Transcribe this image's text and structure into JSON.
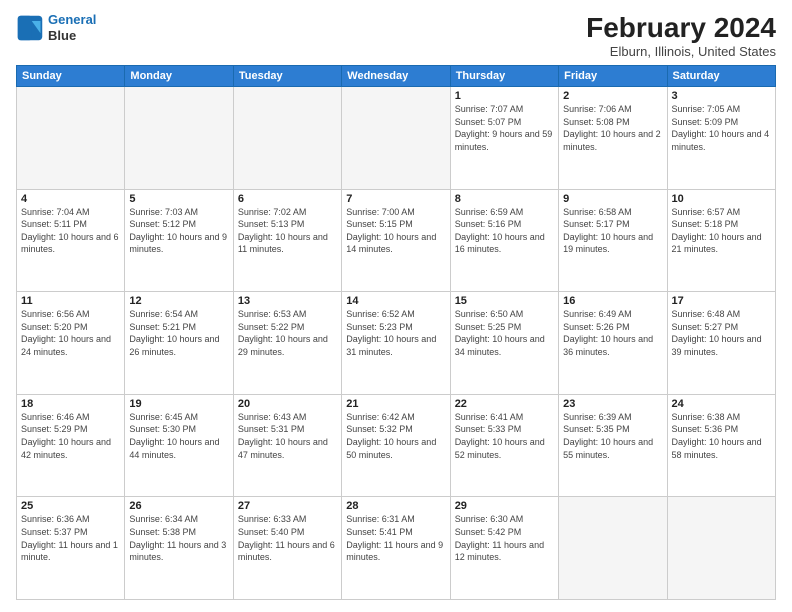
{
  "header": {
    "logo_line1": "General",
    "logo_line2": "Blue",
    "main_title": "February 2024",
    "sub_title": "Elburn, Illinois, United States"
  },
  "weekdays": [
    "Sunday",
    "Monday",
    "Tuesday",
    "Wednesday",
    "Thursday",
    "Friday",
    "Saturday"
  ],
  "weeks": [
    [
      {
        "day": "",
        "info": ""
      },
      {
        "day": "",
        "info": ""
      },
      {
        "day": "",
        "info": ""
      },
      {
        "day": "",
        "info": ""
      },
      {
        "day": "1",
        "info": "Sunrise: 7:07 AM\nSunset: 5:07 PM\nDaylight: 9 hours and 59 minutes."
      },
      {
        "day": "2",
        "info": "Sunrise: 7:06 AM\nSunset: 5:08 PM\nDaylight: 10 hours and 2 minutes."
      },
      {
        "day": "3",
        "info": "Sunrise: 7:05 AM\nSunset: 5:09 PM\nDaylight: 10 hours and 4 minutes."
      }
    ],
    [
      {
        "day": "4",
        "info": "Sunrise: 7:04 AM\nSunset: 5:11 PM\nDaylight: 10 hours and 6 minutes."
      },
      {
        "day": "5",
        "info": "Sunrise: 7:03 AM\nSunset: 5:12 PM\nDaylight: 10 hours and 9 minutes."
      },
      {
        "day": "6",
        "info": "Sunrise: 7:02 AM\nSunset: 5:13 PM\nDaylight: 10 hours and 11 minutes."
      },
      {
        "day": "7",
        "info": "Sunrise: 7:00 AM\nSunset: 5:15 PM\nDaylight: 10 hours and 14 minutes."
      },
      {
        "day": "8",
        "info": "Sunrise: 6:59 AM\nSunset: 5:16 PM\nDaylight: 10 hours and 16 minutes."
      },
      {
        "day": "9",
        "info": "Sunrise: 6:58 AM\nSunset: 5:17 PM\nDaylight: 10 hours and 19 minutes."
      },
      {
        "day": "10",
        "info": "Sunrise: 6:57 AM\nSunset: 5:18 PM\nDaylight: 10 hours and 21 minutes."
      }
    ],
    [
      {
        "day": "11",
        "info": "Sunrise: 6:56 AM\nSunset: 5:20 PM\nDaylight: 10 hours and 24 minutes."
      },
      {
        "day": "12",
        "info": "Sunrise: 6:54 AM\nSunset: 5:21 PM\nDaylight: 10 hours and 26 minutes."
      },
      {
        "day": "13",
        "info": "Sunrise: 6:53 AM\nSunset: 5:22 PM\nDaylight: 10 hours and 29 minutes."
      },
      {
        "day": "14",
        "info": "Sunrise: 6:52 AM\nSunset: 5:23 PM\nDaylight: 10 hours and 31 minutes."
      },
      {
        "day": "15",
        "info": "Sunrise: 6:50 AM\nSunset: 5:25 PM\nDaylight: 10 hours and 34 minutes."
      },
      {
        "day": "16",
        "info": "Sunrise: 6:49 AM\nSunset: 5:26 PM\nDaylight: 10 hours and 36 minutes."
      },
      {
        "day": "17",
        "info": "Sunrise: 6:48 AM\nSunset: 5:27 PM\nDaylight: 10 hours and 39 minutes."
      }
    ],
    [
      {
        "day": "18",
        "info": "Sunrise: 6:46 AM\nSunset: 5:29 PM\nDaylight: 10 hours and 42 minutes."
      },
      {
        "day": "19",
        "info": "Sunrise: 6:45 AM\nSunset: 5:30 PM\nDaylight: 10 hours and 44 minutes."
      },
      {
        "day": "20",
        "info": "Sunrise: 6:43 AM\nSunset: 5:31 PM\nDaylight: 10 hours and 47 minutes."
      },
      {
        "day": "21",
        "info": "Sunrise: 6:42 AM\nSunset: 5:32 PM\nDaylight: 10 hours and 50 minutes."
      },
      {
        "day": "22",
        "info": "Sunrise: 6:41 AM\nSunset: 5:33 PM\nDaylight: 10 hours and 52 minutes."
      },
      {
        "day": "23",
        "info": "Sunrise: 6:39 AM\nSunset: 5:35 PM\nDaylight: 10 hours and 55 minutes."
      },
      {
        "day": "24",
        "info": "Sunrise: 6:38 AM\nSunset: 5:36 PM\nDaylight: 10 hours and 58 minutes."
      }
    ],
    [
      {
        "day": "25",
        "info": "Sunrise: 6:36 AM\nSunset: 5:37 PM\nDaylight: 11 hours and 1 minute."
      },
      {
        "day": "26",
        "info": "Sunrise: 6:34 AM\nSunset: 5:38 PM\nDaylight: 11 hours and 3 minutes."
      },
      {
        "day": "27",
        "info": "Sunrise: 6:33 AM\nSunset: 5:40 PM\nDaylight: 11 hours and 6 minutes."
      },
      {
        "day": "28",
        "info": "Sunrise: 6:31 AM\nSunset: 5:41 PM\nDaylight: 11 hours and 9 minutes."
      },
      {
        "day": "29",
        "info": "Sunrise: 6:30 AM\nSunset: 5:42 PM\nDaylight: 11 hours and 12 minutes."
      },
      {
        "day": "",
        "info": ""
      },
      {
        "day": "",
        "info": ""
      }
    ]
  ]
}
